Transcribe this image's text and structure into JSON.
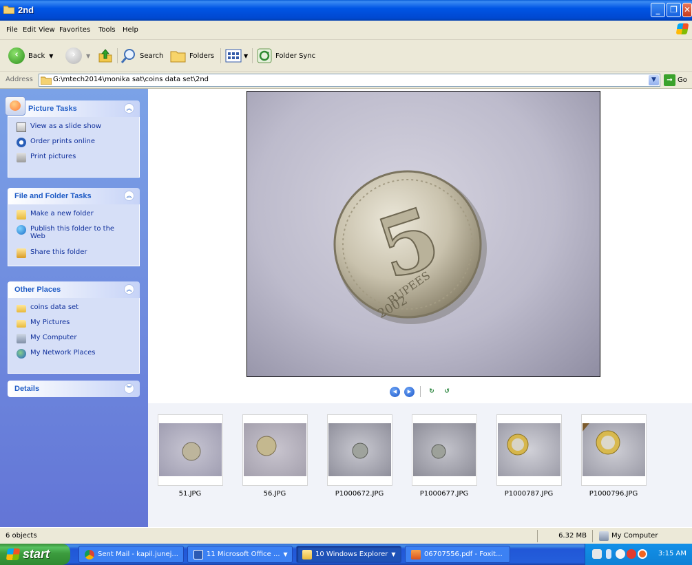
{
  "window": {
    "title": "2nd"
  },
  "menu": [
    "File",
    "Edit",
    "View",
    "Favorites",
    "Tools",
    "Help"
  ],
  "toolbar": {
    "back_label": "Back",
    "search_label": "Search",
    "folders_label": "Folders",
    "foldersync_label": "Folder Sync"
  },
  "address": {
    "label": "Address",
    "value": "G:\\mtech2014\\monika sat\\coins data set\\2nd",
    "go_label": "Go"
  },
  "panels": {
    "picture_tasks": {
      "title": "Picture Tasks",
      "items": [
        "View as a slide show",
        "Order prints online",
        "Print pictures"
      ]
    },
    "file_folder_tasks": {
      "title": "File and Folder Tasks",
      "items": [
        "Make a new folder",
        "Publish this folder to the Web",
        "Share this folder"
      ]
    },
    "other_places": {
      "title": "Other Places",
      "items": [
        "coins data set",
        "My Pictures",
        "My Computer",
        "My Network Places"
      ]
    },
    "details": {
      "title": "Details"
    }
  },
  "coin_text": {
    "value": "5",
    "rupees": "RUPEES",
    "year": "2002"
  },
  "thumbnails": [
    "51.JPG",
    "56.JPG",
    "P1000672.JPG",
    "P1000677.JPG",
    "P1000787.JPG",
    "P1000796.JPG"
  ],
  "status": {
    "objects": "6 objects",
    "size": "6.32 MB",
    "location": "My Computer"
  },
  "taskbar": {
    "start_label": "start",
    "tasks": [
      "Sent Mail - kapil.junej...",
      "11 Microsoft Office ...",
      "10 Windows Explorer",
      "06707556.pdf - Foxit..."
    ],
    "clock": "3:15 AM"
  },
  "colors": {
    "titlebar": "#0055e5",
    "left_pane": "#7ba2e7",
    "panel_title": "#215dc6",
    "taskbar": "#245edb",
    "start": "#3c9c3e"
  }
}
